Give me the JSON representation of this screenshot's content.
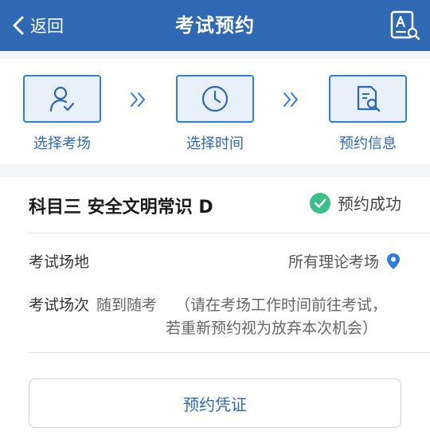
{
  "header": {
    "back_label": "返回",
    "title": "考试预约",
    "icons": {
      "back": "chevron-left-icon",
      "action": "document-search-icon"
    }
  },
  "steps": [
    {
      "label": "选择考场",
      "icon": "user-check-icon"
    },
    {
      "label": "选择时间",
      "icon": "clock-icon"
    },
    {
      "label": "预约信息",
      "icon": "document-search-icon"
    }
  ],
  "card": {
    "subject": "科目三 安全文明常识 D",
    "status": "预约成功",
    "venue": {
      "label": "考试场地",
      "value": "所有理论考场"
    },
    "session": {
      "label": "考试场次",
      "value": "随到随考",
      "note_line1": "（请在考场工作时间前往考试，",
      "note_line2": "若重新预约视为放弃本次机会）"
    },
    "voucher_button": "预约凭证"
  },
  "colors": {
    "primary": "#2f69b3",
    "accent": "#2f7fd9",
    "success": "#3cc08a",
    "step_bg": "#e7f0fb"
  }
}
